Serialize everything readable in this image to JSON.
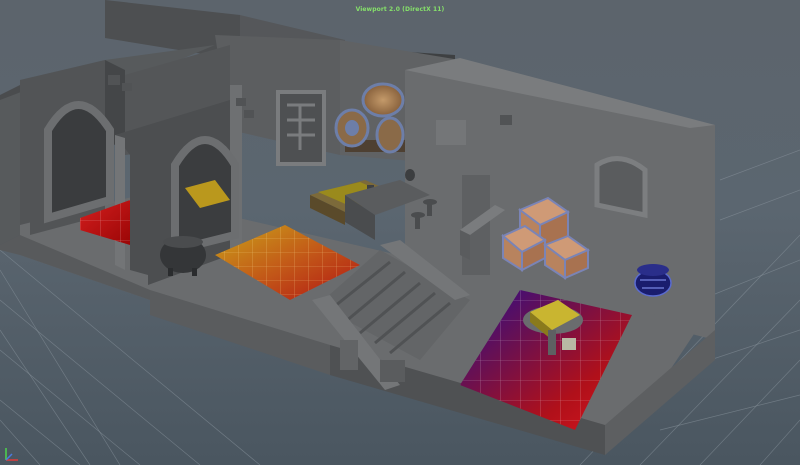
{
  "viewport": {
    "title": "Viewport 2.0 (DirectX 11)",
    "background_color": "#5c646c",
    "grid_color": "#8a959e"
  },
  "scene": {
    "floor_mats": [
      {
        "name": "left-room-mat",
        "colors": [
          "#c4141a",
          "#b00000"
        ]
      },
      {
        "name": "middle-room-mat",
        "colors": [
          "#c8a41a",
          "#b31212"
        ]
      },
      {
        "name": "right-room-mat",
        "colors": [
          "#1a0c8a",
          "#d2151f"
        ]
      }
    ],
    "props": [
      "barrels",
      "crates",
      "cauldron",
      "table",
      "bar-counter",
      "stairs",
      "window",
      "pot",
      "arched-doorway"
    ]
  },
  "gizmo": {
    "icon": "axis-gizmo-icon",
    "colors": {
      "x": "#e03b3b",
      "y": "#4cd64c",
      "z": "#4a7ae0"
    }
  }
}
